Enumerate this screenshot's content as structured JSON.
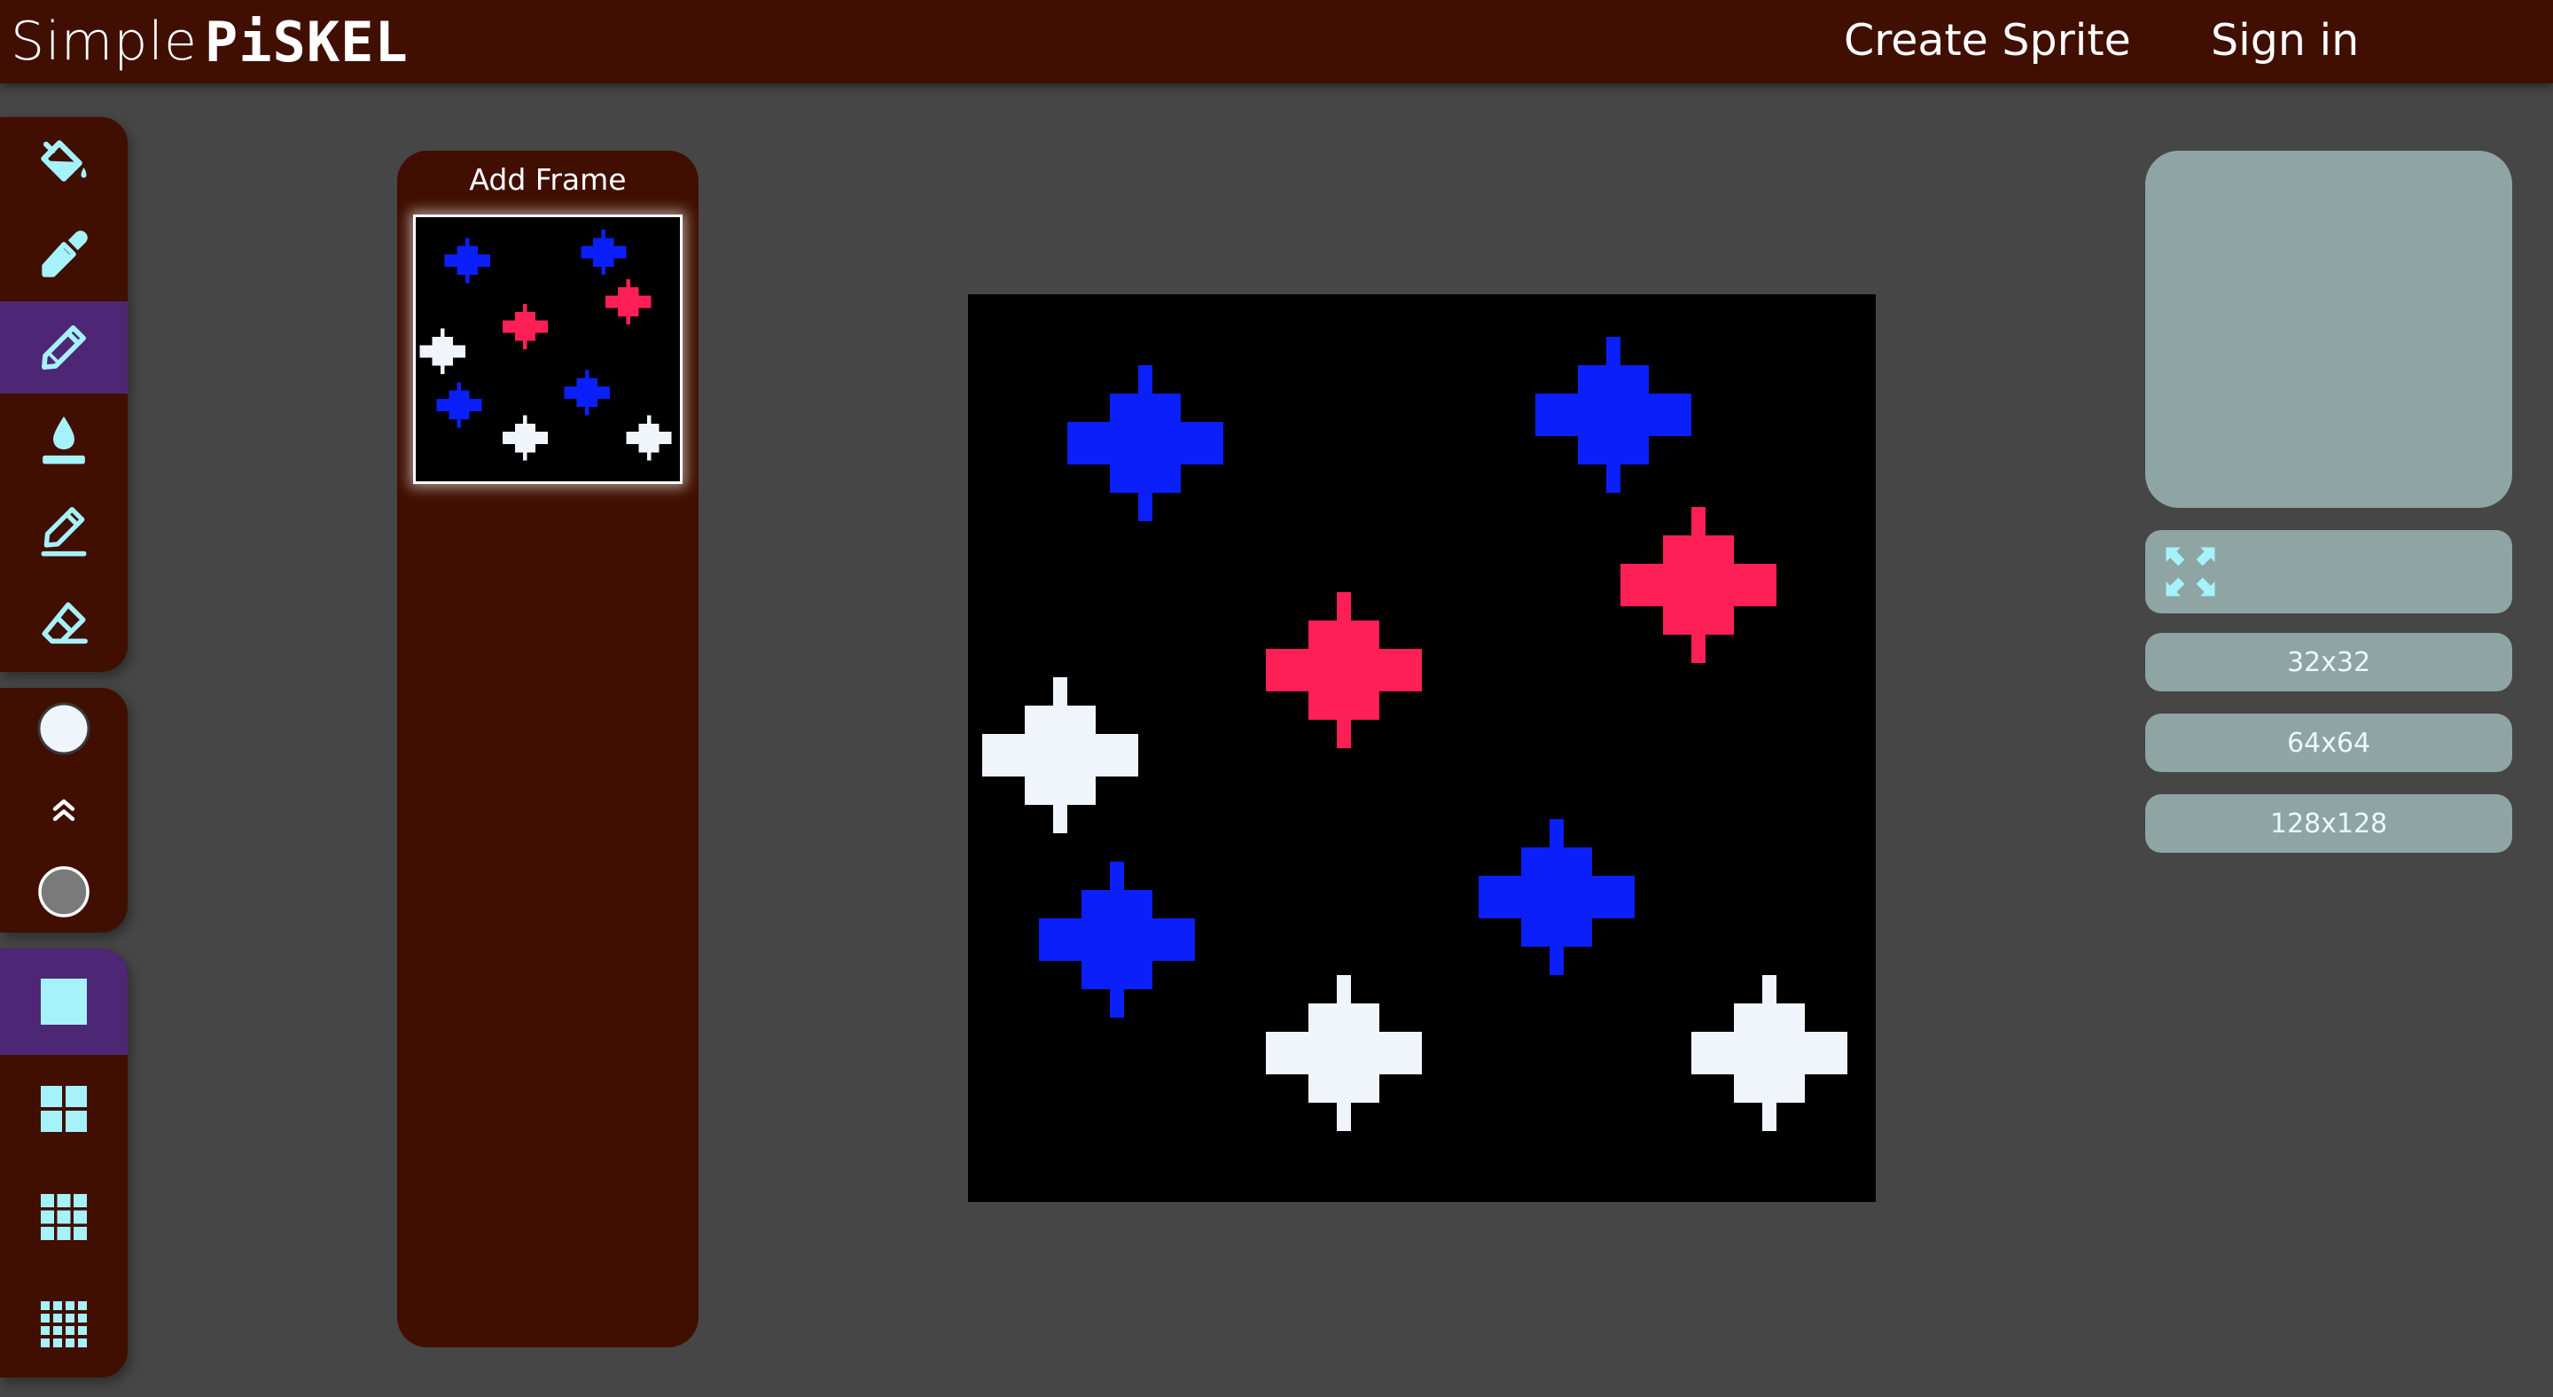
{
  "header": {
    "brand_simple": "Simple",
    "brand_piskel": "PiSKEL",
    "nav": [
      {
        "label": "Create Sprite"
      },
      {
        "label": "Sign in"
      }
    ],
    "background": "#400f02"
  },
  "tools": {
    "draw": [
      "paint-bucket-icon",
      "eyedropper-icon",
      "pencil-icon",
      "color-drop-icon",
      "line-pencil-icon",
      "eraser-icon"
    ],
    "active_tool": "pencil-icon",
    "primary_color": "#f0f5fb",
    "secondary_color": "#7a7a7a",
    "swap_icon": "swap-colors-icon",
    "pen_sizes": [
      "pen-size-1-icon",
      "pen-size-2-icon",
      "pen-size-3-icon",
      "pen-size-4-icon"
    ],
    "active_pen_size": "pen-size-1-icon",
    "active_color": "#4d2775",
    "icon_color": "#a6f2fb"
  },
  "frames": {
    "add_label": "Add Frame",
    "count": 1
  },
  "sprite": {
    "grid_size": 64,
    "background": "#000000",
    "colors": {
      "blue": "#0b1ffa",
      "red": "#ff1f57",
      "white": "#f0f5fb"
    },
    "sparkles": [
      {
        "col": 12,
        "row": 10,
        "color": "blue"
      },
      {
        "col": 45,
        "row": 8,
        "color": "blue"
      },
      {
        "col": 51,
        "row": 20,
        "color": "red"
      },
      {
        "col": 26,
        "row": 26,
        "color": "red"
      },
      {
        "col": 6,
        "row": 32,
        "color": "white"
      },
      {
        "col": 10,
        "row": 45,
        "color": "blue"
      },
      {
        "col": 41,
        "row": 42,
        "color": "blue"
      },
      {
        "col": 26,
        "row": 53,
        "color": "white"
      },
      {
        "col": 56,
        "row": 53,
        "color": "white"
      }
    ]
  },
  "preview_panel": {
    "fullscreen_icon": "expand-arrows-icon",
    "sizes": [
      {
        "label": "32x32"
      },
      {
        "label": "64x64"
      },
      {
        "label": "128x128"
      }
    ],
    "button_color": "#8ea5a4",
    "text_color": "#e8fbff"
  }
}
